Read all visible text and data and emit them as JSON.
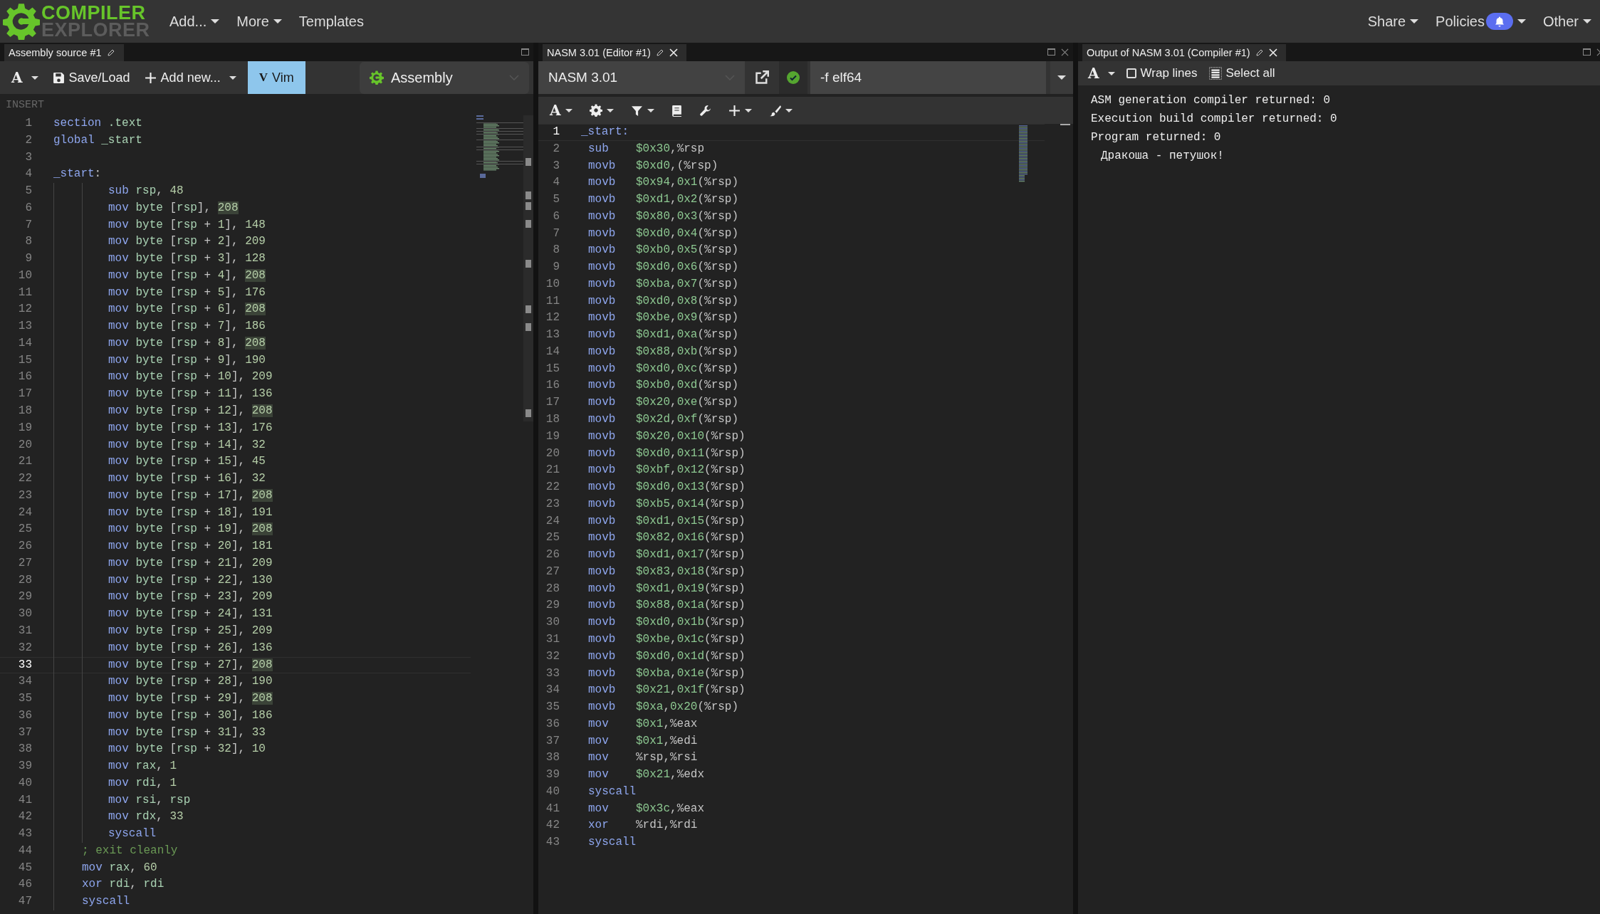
{
  "logo": {
    "line1": "COMPILER",
    "line2": "EXPLORER"
  },
  "nav_left": [
    {
      "label": "Add...",
      "caret": true
    },
    {
      "label": "More",
      "caret": true
    },
    {
      "label": "Templates",
      "caret": false
    }
  ],
  "nav_right": [
    {
      "label": "Share",
      "caret": true,
      "badge": false
    },
    {
      "label": "Policies",
      "caret": true,
      "badge": true
    },
    {
      "label": "Other",
      "caret": true,
      "badge": false
    }
  ],
  "source_panel": {
    "tab": {
      "title": "Assembly source #1",
      "closable": false
    },
    "toolbar": {
      "font": "A",
      "save": "Save/Load",
      "add": "Add new...",
      "vim": {
        "label": "Vim",
        "glyph": "V",
        "selected": true
      },
      "language": "Assembly"
    },
    "mode": "INSERT",
    "lines": [
      {
        "n": "1",
        "kind": "directive",
        "text": "section .text",
        "hl": false,
        "current": false
      },
      {
        "n": "2",
        "kind": "directive",
        "text": "global _start",
        "hl": false,
        "current": false
      },
      {
        "n": "3",
        "kind": "blank",
        "current": false
      },
      {
        "n": "4",
        "kind": "label",
        "text": "_start:",
        "hl": false,
        "current": false
      },
      {
        "n": "5",
        "kind": "instr",
        "text": "sub rsp, 48",
        "hl": false,
        "current": false
      },
      {
        "n": "6",
        "kind": "instr",
        "text": "mov byte [rsp], 208",
        "hl": true,
        "current": false
      },
      {
        "n": "7",
        "kind": "instr",
        "text": "mov byte [rsp + 1], 148",
        "hl": false,
        "current": false
      },
      {
        "n": "8",
        "kind": "instr",
        "text": "mov byte [rsp + 2], 209",
        "hl": false,
        "current": false
      },
      {
        "n": "9",
        "kind": "instr",
        "text": "mov byte [rsp + 3], 128",
        "hl": false,
        "current": false
      },
      {
        "n": "10",
        "kind": "instr",
        "text": "mov byte [rsp + 4], 208",
        "hl": true,
        "current": false
      },
      {
        "n": "11",
        "kind": "instr",
        "text": "mov byte [rsp + 5], 176",
        "hl": false,
        "current": false
      },
      {
        "n": "12",
        "kind": "instr",
        "text": "mov byte [rsp + 6], 208",
        "hl": true,
        "current": false
      },
      {
        "n": "13",
        "kind": "instr",
        "text": "mov byte [rsp + 7], 186",
        "hl": false,
        "current": false
      },
      {
        "n": "14",
        "kind": "instr",
        "text": "mov byte [rsp + 8], 208",
        "hl": true,
        "current": false
      },
      {
        "n": "15",
        "kind": "instr",
        "text": "mov byte [rsp + 9], 190",
        "hl": false,
        "current": false
      },
      {
        "n": "16",
        "kind": "instr",
        "text": "mov byte [rsp + 10], 209",
        "hl": false,
        "current": false
      },
      {
        "n": "17",
        "kind": "instr",
        "text": "mov byte [rsp + 11], 136",
        "hl": false,
        "current": false
      },
      {
        "n": "18",
        "kind": "instr",
        "text": "mov byte [rsp + 12], 208",
        "hl": true,
        "current": false
      },
      {
        "n": "19",
        "kind": "instr",
        "text": "mov byte [rsp + 13], 176",
        "hl": false,
        "current": false
      },
      {
        "n": "20",
        "kind": "instr",
        "text": "mov byte [rsp + 14], 32",
        "hl": false,
        "current": false
      },
      {
        "n": "21",
        "kind": "instr",
        "text": "mov byte [rsp + 15], 45",
        "hl": false,
        "current": false
      },
      {
        "n": "22",
        "kind": "instr",
        "text": "mov byte [rsp + 16], 32",
        "hl": false,
        "current": false
      },
      {
        "n": "23",
        "kind": "instr",
        "text": "mov byte [rsp + 17], 208",
        "hl": true,
        "current": false
      },
      {
        "n": "24",
        "kind": "instr",
        "text": "mov byte [rsp + 18], 191",
        "hl": false,
        "current": false
      },
      {
        "n": "25",
        "kind": "instr",
        "text": "mov byte [rsp + 19], 208",
        "hl": true,
        "current": false
      },
      {
        "n": "26",
        "kind": "instr",
        "text": "mov byte [rsp + 20], 181",
        "hl": false,
        "current": false
      },
      {
        "n": "27",
        "kind": "instr",
        "text": "mov byte [rsp + 21], 209",
        "hl": false,
        "current": false
      },
      {
        "n": "28",
        "kind": "instr",
        "text": "mov byte [rsp + 22], 130",
        "hl": false,
        "current": false
      },
      {
        "n": "29",
        "kind": "instr",
        "text": "mov byte [rsp + 23], 209",
        "hl": false,
        "current": false
      },
      {
        "n": "30",
        "kind": "instr",
        "text": "mov byte [rsp + 24], 131",
        "hl": false,
        "current": false
      },
      {
        "n": "31",
        "kind": "instr",
        "text": "mov byte [rsp + 25], 209",
        "hl": false,
        "current": false
      },
      {
        "n": "32",
        "kind": "instr",
        "text": "mov byte [rsp + 26], 136",
        "hl": false,
        "current": false
      },
      {
        "n": "33",
        "kind": "instr",
        "text": "mov byte [rsp + 27], 208",
        "hl": true,
        "current": true
      },
      {
        "n": "34",
        "kind": "instr",
        "text": "mov byte [rsp + 28], 190",
        "hl": false,
        "current": false
      },
      {
        "n": "35",
        "kind": "instr",
        "text": "mov byte [rsp + 29], 208",
        "hl": true,
        "current": false
      },
      {
        "n": "36",
        "kind": "instr",
        "text": "mov byte [rsp + 30], 186",
        "hl": false,
        "current": false
      },
      {
        "n": "37",
        "kind": "instr",
        "text": "mov byte [rsp + 31], 33",
        "hl": false,
        "current": false
      },
      {
        "n": "38",
        "kind": "instr",
        "text": "mov byte [rsp + 32], 10",
        "hl": false,
        "current": false
      },
      {
        "n": "39",
        "kind": "instr",
        "text": "mov rax, 1",
        "hl": false,
        "current": false
      },
      {
        "n": "40",
        "kind": "instr",
        "text": "mov rdi, 1",
        "hl": false,
        "current": false
      },
      {
        "n": "41",
        "kind": "instr",
        "text": "mov rsi, rsp",
        "hl": false,
        "current": false
      },
      {
        "n": "42",
        "kind": "instr",
        "text": "mov rdx, 33",
        "hl": false,
        "current": false
      },
      {
        "n": "43",
        "kind": "instr",
        "text": "syscall",
        "hl": false,
        "current": false
      },
      {
        "n": "44",
        "kind": "comment",
        "text": "; exit cleanly",
        "hl": false,
        "current": false
      },
      {
        "n": "45",
        "kind": "body",
        "text": "mov rax, 60",
        "hl": false,
        "current": false
      },
      {
        "n": "46",
        "kind": "body",
        "text": "xor rdi, rdi",
        "hl": false,
        "current": false
      },
      {
        "n": "47",
        "kind": "body",
        "text": "syscall",
        "hl": false,
        "current": false
      }
    ]
  },
  "compiler_panel": {
    "tab": {
      "title": "NASM 3.01 (Editor #1)",
      "closable": true
    },
    "compiler": "NASM 3.01",
    "compiled": true,
    "options": "-f elf64",
    "tools": [
      {
        "kind": "font",
        "glyph": "A",
        "caret": true
      },
      {
        "kind": "gear",
        "caret": true
      },
      {
        "kind": "filter",
        "caret": true
      },
      {
        "kind": "book",
        "caret": false
      },
      {
        "kind": "wrench",
        "caret": false
      },
      {
        "kind": "plus",
        "caret": true
      },
      {
        "kind": "brush",
        "caret": true
      }
    ],
    "lines": [
      {
        "n": "1",
        "kind": "label",
        "op": "_start:",
        "current": true
      },
      {
        "n": "2",
        "kind": "instr",
        "op": "sub",
        "args": "$0x30,%rsp",
        "current": false
      },
      {
        "n": "3",
        "kind": "instr",
        "op": "movb",
        "args": "$0xd0,(%rsp)",
        "current": false
      },
      {
        "n": "4",
        "kind": "instr",
        "op": "movb",
        "args": "$0x94,0x1(%rsp)",
        "current": false
      },
      {
        "n": "5",
        "kind": "instr",
        "op": "movb",
        "args": "$0xd1,0x2(%rsp)",
        "current": false
      },
      {
        "n": "6",
        "kind": "instr",
        "op": "movb",
        "args": "$0x80,0x3(%rsp)",
        "current": false
      },
      {
        "n": "7",
        "kind": "instr",
        "op": "movb",
        "args": "$0xd0,0x4(%rsp)",
        "current": false
      },
      {
        "n": "8",
        "kind": "instr",
        "op": "movb",
        "args": "$0xb0,0x5(%rsp)",
        "current": false
      },
      {
        "n": "9",
        "kind": "instr",
        "op": "movb",
        "args": "$0xd0,0x6(%rsp)",
        "current": false
      },
      {
        "n": "10",
        "kind": "instr",
        "op": "movb",
        "args": "$0xba,0x7(%rsp)",
        "current": false
      },
      {
        "n": "11",
        "kind": "instr",
        "op": "movb",
        "args": "$0xd0,0x8(%rsp)",
        "current": false
      },
      {
        "n": "12",
        "kind": "instr",
        "op": "movb",
        "args": "$0xbe,0x9(%rsp)",
        "current": false
      },
      {
        "n": "13",
        "kind": "instr",
        "op": "movb",
        "args": "$0xd1,0xa(%rsp)",
        "current": false
      },
      {
        "n": "14",
        "kind": "instr",
        "op": "movb",
        "args": "$0x88,0xb(%rsp)",
        "current": false
      },
      {
        "n": "15",
        "kind": "instr",
        "op": "movb",
        "args": "$0xd0,0xc(%rsp)",
        "current": false
      },
      {
        "n": "16",
        "kind": "instr",
        "op": "movb",
        "args": "$0xb0,0xd(%rsp)",
        "current": false
      },
      {
        "n": "17",
        "kind": "instr",
        "op": "movb",
        "args": "$0x20,0xe(%rsp)",
        "current": false
      },
      {
        "n": "18",
        "kind": "instr",
        "op": "movb",
        "args": "$0x2d,0xf(%rsp)",
        "current": false
      },
      {
        "n": "19",
        "kind": "instr",
        "op": "movb",
        "args": "$0x20,0x10(%rsp)",
        "current": false
      },
      {
        "n": "20",
        "kind": "instr",
        "op": "movb",
        "args": "$0xd0,0x11(%rsp)",
        "current": false
      },
      {
        "n": "21",
        "kind": "instr",
        "op": "movb",
        "args": "$0xbf,0x12(%rsp)",
        "current": false
      },
      {
        "n": "22",
        "kind": "instr",
        "op": "movb",
        "args": "$0xd0,0x13(%rsp)",
        "current": false
      },
      {
        "n": "23",
        "kind": "instr",
        "op": "movb",
        "args": "$0xb5,0x14(%rsp)",
        "current": false
      },
      {
        "n": "24",
        "kind": "instr",
        "op": "movb",
        "args": "$0xd1,0x15(%rsp)",
        "current": false
      },
      {
        "n": "25",
        "kind": "instr",
        "op": "movb",
        "args": "$0x82,0x16(%rsp)",
        "current": false
      },
      {
        "n": "26",
        "kind": "instr",
        "op": "movb",
        "args": "$0xd1,0x17(%rsp)",
        "current": false
      },
      {
        "n": "27",
        "kind": "instr",
        "op": "movb",
        "args": "$0x83,0x18(%rsp)",
        "current": false
      },
      {
        "n": "28",
        "kind": "instr",
        "op": "movb",
        "args": "$0xd1,0x19(%rsp)",
        "current": false
      },
      {
        "n": "29",
        "kind": "instr",
        "op": "movb",
        "args": "$0x88,0x1a(%rsp)",
        "current": false
      },
      {
        "n": "30",
        "kind": "instr",
        "op": "movb",
        "args": "$0xd0,0x1b(%rsp)",
        "current": false
      },
      {
        "n": "31",
        "kind": "instr",
        "op": "movb",
        "args": "$0xbe,0x1c(%rsp)",
        "current": false
      },
      {
        "n": "32",
        "kind": "instr",
        "op": "movb",
        "args": "$0xd0,0x1d(%rsp)",
        "current": false
      },
      {
        "n": "33",
        "kind": "instr",
        "op": "movb",
        "args": "$0xba,0x1e(%rsp)",
        "current": false
      },
      {
        "n": "34",
        "kind": "instr",
        "op": "movb",
        "args": "$0x21,0x1f(%rsp)",
        "current": false
      },
      {
        "n": "35",
        "kind": "instr",
        "op": "movb",
        "args": "$0xa,0x20(%rsp)",
        "current": false
      },
      {
        "n": "36",
        "kind": "instr",
        "op": "mov",
        "args": "$0x1,%eax",
        "current": false
      },
      {
        "n": "37",
        "kind": "instr",
        "op": "mov",
        "args": "$0x1,%edi",
        "current": false
      },
      {
        "n": "38",
        "kind": "instr",
        "op": "mov",
        "args": "%rsp,%rsi",
        "current": false
      },
      {
        "n": "39",
        "kind": "instr",
        "op": "mov",
        "args": "$0x21,%edx",
        "current": false
      },
      {
        "n": "40",
        "kind": "instr",
        "op": "syscall",
        "current": false
      },
      {
        "n": "41",
        "kind": "instr",
        "op": "mov",
        "args": "$0x3c,%eax",
        "current": false
      },
      {
        "n": "42",
        "kind": "instr",
        "op": "xor",
        "args": "%rdi,%rdi",
        "current": false
      },
      {
        "n": "43",
        "kind": "instr",
        "op": "syscall",
        "current": false
      }
    ]
  },
  "output_panel": {
    "tab": {
      "title": "Output of NASM 3.01 (Compiler #1)",
      "closable": true
    },
    "font": "A",
    "wrap": {
      "label": "Wrap lines",
      "checked": false
    },
    "select_all": "Select all",
    "lines": [
      {
        "kind": "status",
        "text": "ASM generation compiler returned: 0"
      },
      {
        "kind": "status",
        "text": "Execution build compiler returned: 0"
      },
      {
        "kind": "status",
        "text": "Program returned: 0"
      },
      {
        "kind": "stdout",
        "text": "Дракоша - петушок!"
      }
    ]
  }
}
